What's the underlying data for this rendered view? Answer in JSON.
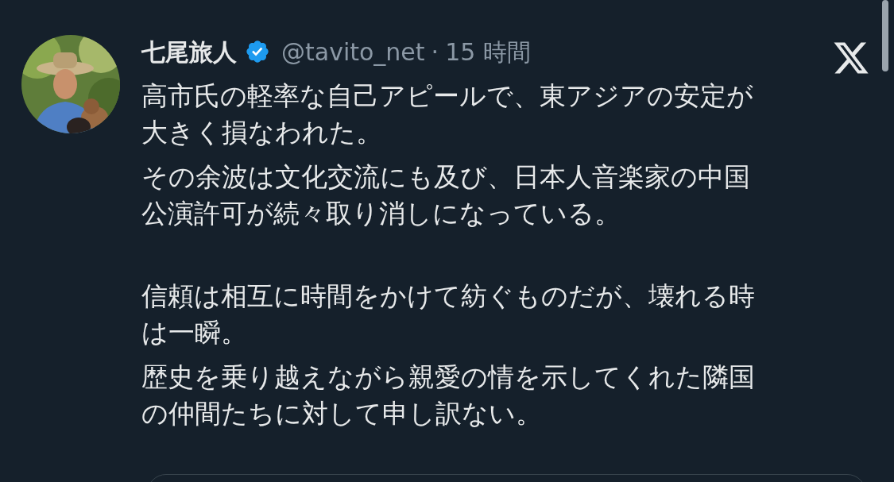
{
  "post": {
    "author": {
      "name": "七尾旅人",
      "verified": true,
      "handle": "@tavito_net",
      "separator": "·",
      "time": "15 時間"
    },
    "blocks": [
      {
        "paragraphs": [
          {
            "lines": [
              "高市氏の軽率な自己アピールで、東アジアの安定が",
              "大きく損なわれた。"
            ]
          },
          {
            "lines": [
              "その余波は文化交流にも及び、日本人音楽家の中国",
              "公演許可が続々取り消しになっている。"
            ]
          }
        ]
      },
      {
        "paragraphs": [
          {
            "lines": [
              "信頼は相互に時間をかけて紡ぐものだが、壊れる時",
              "は一瞬。"
            ]
          },
          {
            "lines": [
              "歴史を乗り越えながら親愛の情を示してくれた隣国",
              "の仲間たちに対して申し訳ない。"
            ]
          }
        ]
      }
    ]
  }
}
